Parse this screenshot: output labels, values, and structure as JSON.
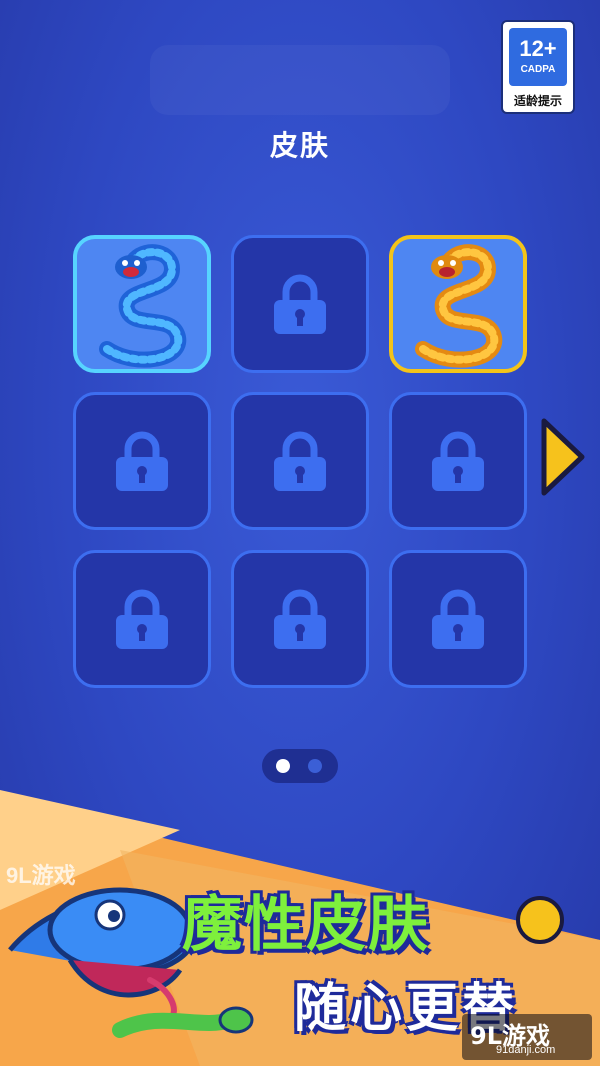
{
  "rating": {
    "age": "12+",
    "org": "CADPA",
    "tip": "适龄提示"
  },
  "title": "皮肤",
  "tiles": [
    {
      "state": "unlocked",
      "skin": "blue-snake"
    },
    {
      "state": "locked"
    },
    {
      "state": "unlocked",
      "skin": "gold-snake"
    },
    {
      "state": "locked"
    },
    {
      "state": "locked"
    },
    {
      "state": "locked"
    },
    {
      "state": "locked"
    },
    {
      "state": "locked"
    },
    {
      "state": "locked"
    }
  ],
  "pager": {
    "current": 1,
    "total": 2
  },
  "promo": {
    "line1": "魔性皮肤",
    "line2": "随心更替"
  },
  "watermark": {
    "top": "9L游戏",
    "brand": "9L游戏",
    "url": "91danji.com"
  },
  "colors": {
    "background": "#2e48c2",
    "tile": "#2436a8",
    "tile_border": "#3d6ef0",
    "selected_blue": "#57d4ff",
    "selected_gold": "#f3c419",
    "promo_green": "#7ef03c"
  }
}
